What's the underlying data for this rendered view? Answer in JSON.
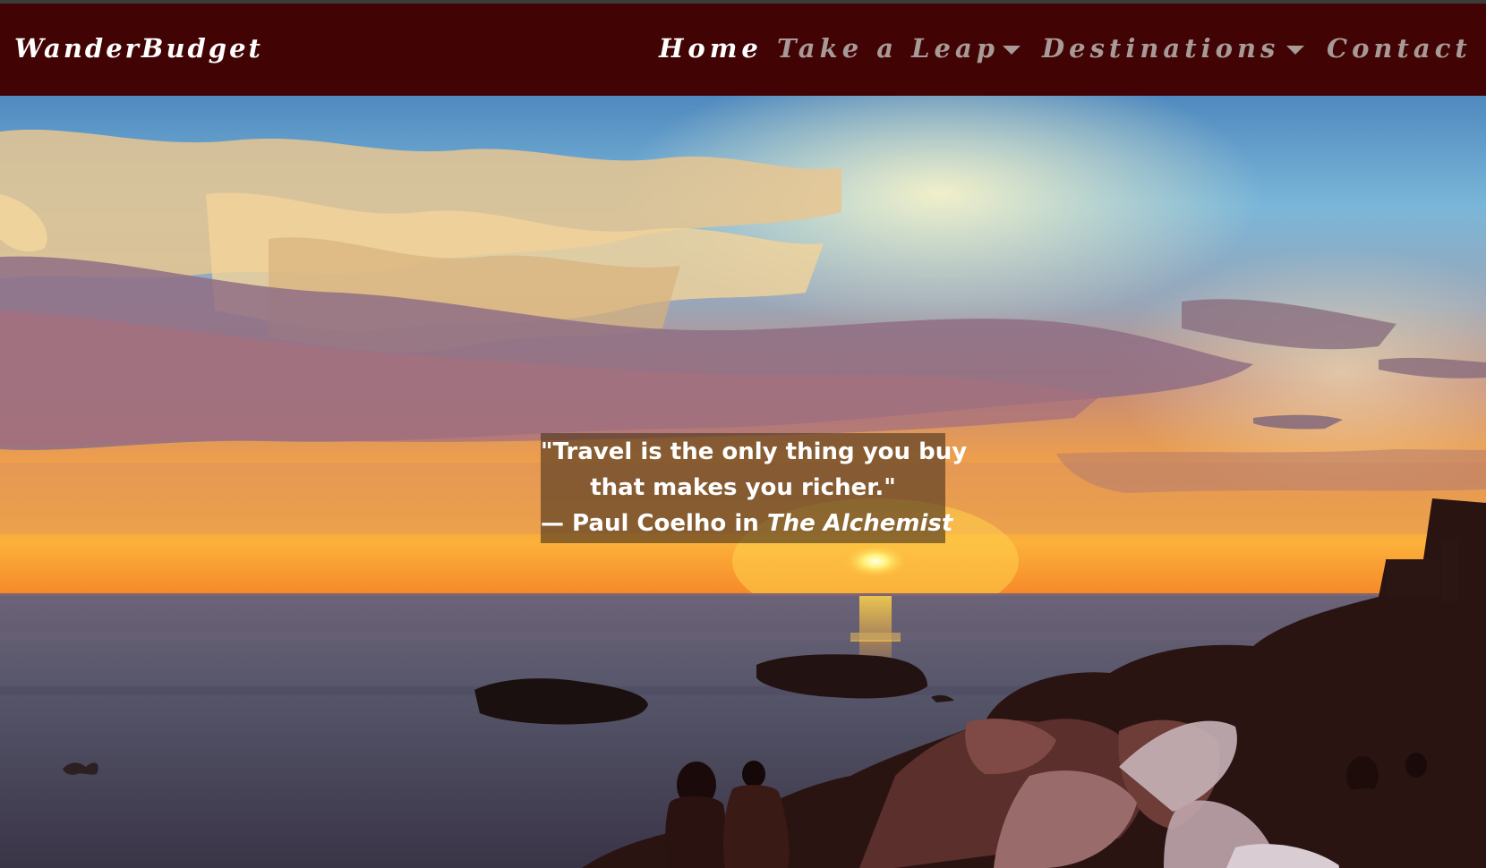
{
  "navbar": {
    "brand": "WanderBudget",
    "items": [
      {
        "label": "Home",
        "active": true
      },
      {
        "label": "Take a Leap",
        "dropdown": true
      },
      {
        "label": "Destinations",
        "dropdown": true
      },
      {
        "label": "Contact"
      }
    ],
    "colors": {
      "background": "#410303",
      "active_text": "#ffffff",
      "inactive_text": "#a79a97"
    }
  },
  "hero": {
    "image": "sunset-over-sea-photo",
    "quote": {
      "line1": "\"Travel is the only thing you buy",
      "line2": "that makes you richer.\"",
      "attribution_prefix": "— Paul Coelho in",
      "source": "The Alchemist"
    }
  }
}
